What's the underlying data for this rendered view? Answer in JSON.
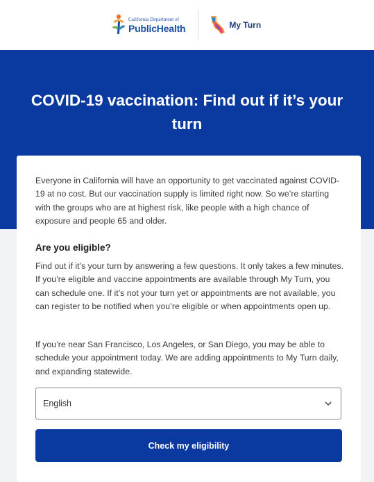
{
  "header": {
    "cdph_line1": "California Department of",
    "cdph_line2": "PublicHealth",
    "myturn_label": "My Turn"
  },
  "hero": {
    "title": "COVID-19 vaccination: Find out if it’s your turn"
  },
  "card": {
    "intro": "Everyone in California will have an opportunity to get vaccinated against COVID-19 at no cost. But our vaccination supply is limited right now. So we’re starting with the groups who are at highest risk, like people with a high chance of exposure and people 65 and older.",
    "eligible_heading": "Are you eligible?",
    "eligible_body": "Find out if it’s your turn by answering a few questions. It only takes a few minutes. If you’re eligible and vaccine appointments are available through My Turn, you can schedule one. If it’s not your turn yet or appointments are not available, you can register to be notified when you’re eligible or when appointments open up.",
    "near_text": "If you’re near San Francisco, Los Angeles, or San Diego, you may be able to schedule your appointment today. We are adding appointments to My Turn daily, and expanding statewide."
  },
  "language_select": {
    "value": "English",
    "icon": "chevron-down-icon"
  },
  "check_button": {
    "label": "Check my eligibility"
  },
  "colors": {
    "primary_blue": "#0a3aa0",
    "page_bg": "#f2f3f5"
  }
}
